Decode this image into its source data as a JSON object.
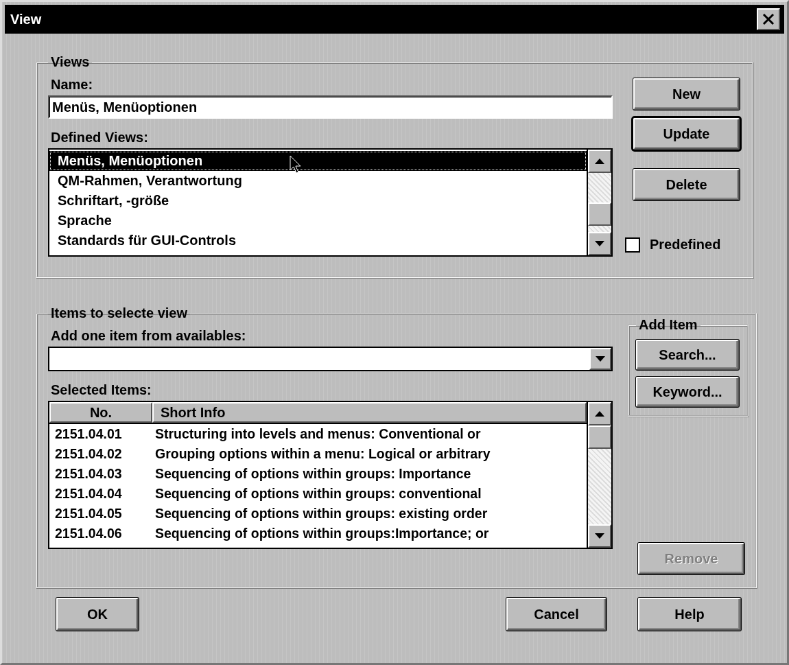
{
  "window": {
    "title": "View"
  },
  "views": {
    "title": "Views",
    "name_label": "Name:",
    "name_value": "Menüs, Menüoptionen",
    "defined_label": "Defined Views:",
    "defined_views": [
      {
        "label": "Menüs, Menüoptionen",
        "selected": true
      },
      {
        "label": "QM-Rahmen, Verantwortung",
        "selected": false
      },
      {
        "label": "Schriftart, -größe",
        "selected": false
      },
      {
        "label": "Sprache",
        "selected": false
      },
      {
        "label": "Standards für GUI-Controls",
        "selected": false
      }
    ],
    "buttons": [
      {
        "label": "New",
        "kind": "normal"
      },
      {
        "label": "Update",
        "kind": "default"
      },
      {
        "label": "Delete",
        "kind": "normal"
      }
    ],
    "predefined": {
      "label": "Predefined",
      "checked": false
    }
  },
  "items": {
    "title": "Items to selecte view",
    "add_label": "Add one item from availables:",
    "selected_label": "Selected Items:",
    "table": {
      "columns": [
        "No.",
        "Short Info"
      ],
      "rows": [
        [
          "2151.04.01",
          "Structuring into levels and menus: Conventional or"
        ],
        [
          "2151.04.02",
          "Grouping options within a menu: Logical or arbitrary"
        ],
        [
          "2151.04.03",
          "Sequencing of options within groups: Importance"
        ],
        [
          "2151.04.04",
          "Sequencing of options within groups: conventional"
        ],
        [
          "2151.04.05",
          "Sequencing of options within groups: existing order"
        ],
        [
          "2151.04.06",
          "Sequencing of options within groups:Importance; or"
        ]
      ]
    },
    "add_item": {
      "title": "Add Item",
      "buttons": [
        {
          "label": "Search..."
        },
        {
          "label": "Keyword..."
        }
      ]
    },
    "remove": {
      "label": "Remove",
      "disabled": true
    }
  },
  "footer": {
    "buttons": [
      {
        "label": "OK"
      },
      {
        "label": "Cancel"
      },
      {
        "label": "Help"
      }
    ]
  }
}
